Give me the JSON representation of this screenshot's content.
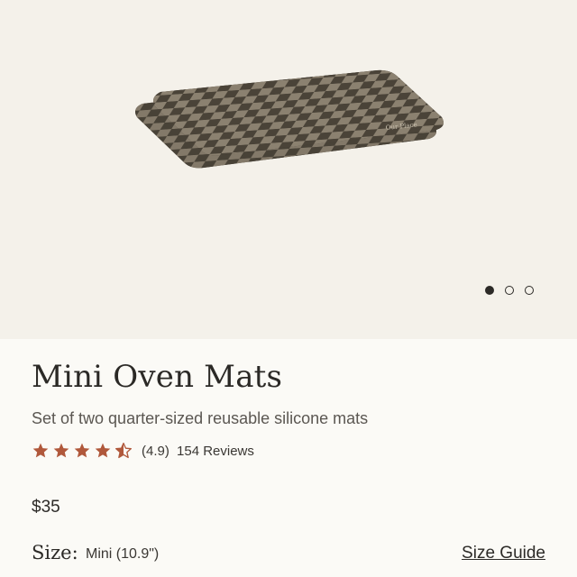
{
  "product": {
    "title": "Mini Oven Mats",
    "subtitle": "Set of two quarter-sized reusable silicone mats",
    "rating": {
      "value": 4.5,
      "label": "(4.9)",
      "reviews": "154 Reviews",
      "star_color": "#b0583b"
    },
    "price": "$35",
    "size": {
      "label": "Size:",
      "value": "Mini (10.9\")",
      "guide": "Size Guide"
    },
    "image": {
      "logo_text": "Our Place",
      "colors": {
        "dark": "#4a4338",
        "light": "#8c8270"
      }
    }
  },
  "gallery": {
    "slides": 3,
    "active": 0
  }
}
